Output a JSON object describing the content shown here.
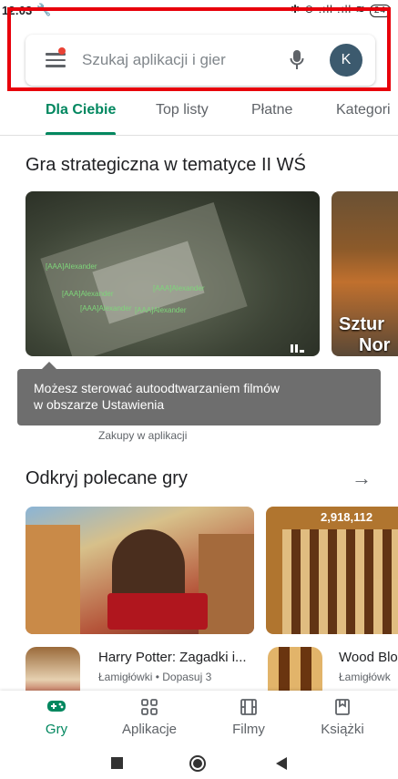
{
  "status_bar": {
    "time": "12:03",
    "wrench_icon": "🔧",
    "indicators": "✱ ⊙ .ıll .ıll ≋",
    "battery": "24"
  },
  "search": {
    "placeholder": "Szukaj aplikacji i gier",
    "avatar_letter": "K"
  },
  "tabs": [
    {
      "label": "Dla Ciebie",
      "active": true
    },
    {
      "label": "Top listy",
      "active": false
    },
    {
      "label": "Płatne",
      "active": false
    },
    {
      "label": "Kategori",
      "active": false
    }
  ],
  "section1": {
    "title": "Gra strategiczna w tematyce II WŚ",
    "second_card_text": [
      "Sztur",
      "Nor"
    ],
    "video_tags": [
      "[AAA]Alexander",
      "[AAA]Alexander",
      "[AAA]Alexander",
      "[AAA]Alexander",
      "[AAA]Alexander"
    ],
    "subtext": "Zakupy w aplikacji"
  },
  "tooltip": {
    "text_line1": "Możesz sterować autoodtwarzaniem filmów",
    "text_line2": "w obszarze Ustawienia"
  },
  "section2": {
    "title": "Odkryj polecane gry",
    "arrow": "→",
    "game2_score": "2,918,112",
    "apps": [
      {
        "name": "Harry Potter: Zagadki i...",
        "meta": "Łamigłówki • Dopasuj 3"
      },
      {
        "name": "Wood Blo",
        "meta": "Łamigłówk"
      }
    ]
  },
  "bottom_nav": [
    {
      "label": "Gry",
      "icon": "gamepad-icon",
      "active": true
    },
    {
      "label": "Aplikacje",
      "icon": "apps-grid-icon",
      "active": false
    },
    {
      "label": "Filmy",
      "icon": "film-icon",
      "active": false
    },
    {
      "label": "Książki",
      "icon": "bookmark-icon",
      "active": false
    }
  ],
  "colors": {
    "accent": "#01875f",
    "highlight_frame": "#e8000b",
    "tooltip_bg": "#6e6e6e",
    "avatar_bg": "#3c5a6e"
  }
}
